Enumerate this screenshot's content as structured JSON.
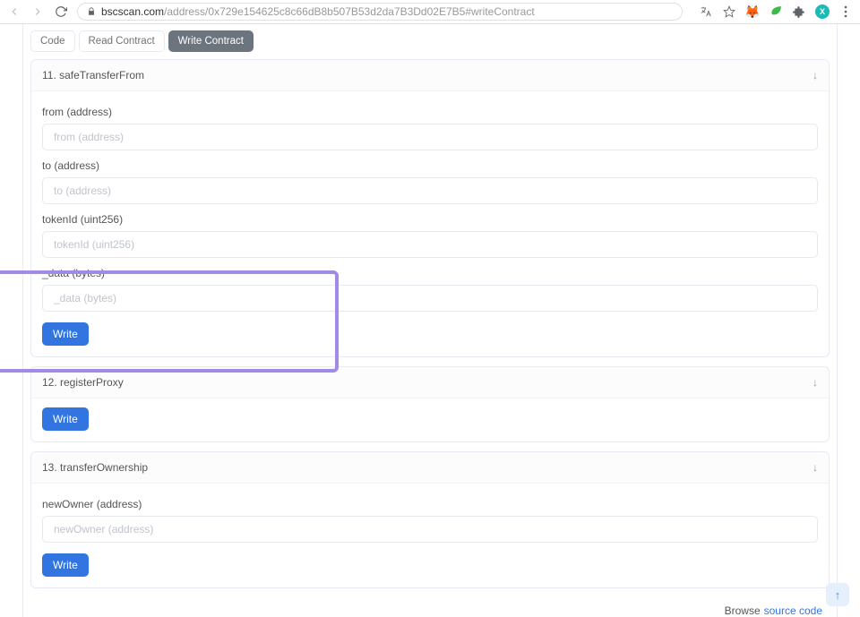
{
  "browser": {
    "url_host": "bscscan.com",
    "url_path": "/address/0x729e154625c8c66dB8b507B53d2da7B3Dd02E7B5#writeContract",
    "avatar_letter": "X"
  },
  "tabs": {
    "code": "Code",
    "read": "Read Contract",
    "write": "Write Contract"
  },
  "fn11": {
    "title": "11. safeTransferFrom",
    "from_label": "from (address)",
    "from_ph": "from (address)",
    "to_label": "to (address)",
    "to_ph": "to (address)",
    "tokenId_label": "tokenId (uint256)",
    "tokenId_ph": "tokenId (uint256)",
    "data_label": "_data (bytes)",
    "data_ph": "_data (bytes)",
    "write": "Write"
  },
  "fn12": {
    "title": "12. registerProxy",
    "write": "Write"
  },
  "fn13": {
    "title": "13. transferOwnership",
    "newOwner_label": "newOwner (address)",
    "newOwner_ph": "newOwner (address)",
    "write": "Write"
  },
  "footer": {
    "browse": "Browse",
    "link": "source code"
  }
}
